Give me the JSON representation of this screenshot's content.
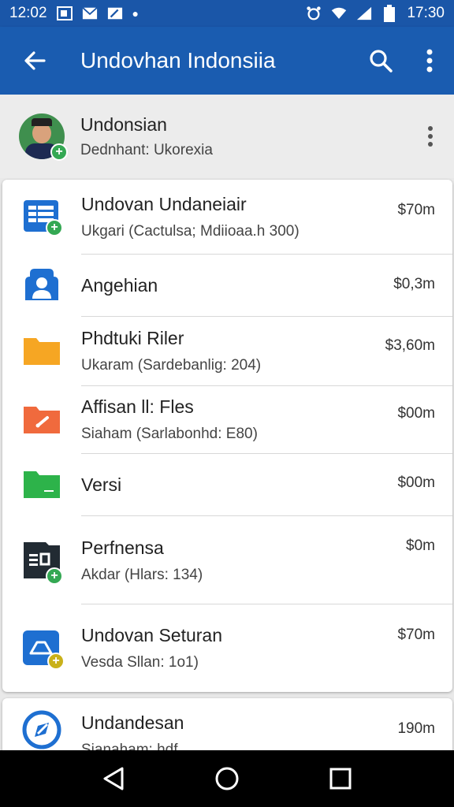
{
  "status_bar": {
    "time_left": "12:02",
    "time_right": "17:30"
  },
  "app_bar": {
    "title": "Undovhan Indonsiia"
  },
  "profile": {
    "name": "Undonsian",
    "subtitle": "Dednhant: Ukorexia"
  },
  "items": [
    {
      "name": "Undovan Undaneiair",
      "sub": "Ukgari (Cactulsa; Mdiioaa.h 300)",
      "size": "$70m",
      "icon": "spreadsheet-icon",
      "color": "#1e6fd1"
    },
    {
      "name": "Angehian",
      "sub": "",
      "size": "$0,3m",
      "icon": "contacts-icon",
      "color": "#1e6fd1"
    },
    {
      "name": "Phdtuki Riler",
      "sub": "Ukaram (Sardebanlig: 204)",
      "size": "$3,60m",
      "icon": "folder-icon",
      "color": "#f6a623"
    },
    {
      "name": "Affisan ll: Fles",
      "sub": "Siaham (Sarlabonhd: E80)",
      "size": "$00m",
      "icon": "folder-icon",
      "color": "#f06a3d"
    },
    {
      "name": "Versi",
      "sub": "",
      "size": "$00m",
      "icon": "folder-icon",
      "color": "#2db34a"
    },
    {
      "name": "Perfnensa",
      "sub": "Akdar (Hlars: 134)",
      "size": "$0m",
      "icon": "document-icon",
      "color": "#222b33"
    },
    {
      "name": "Undovan Seturan",
      "sub": "Vesda Sllan: 1o1)",
      "size": "$70m",
      "icon": "drive-icon",
      "color": "#1e6fd1"
    }
  ],
  "partial_item": {
    "name": "Undandesan",
    "sub": "Sianaham: hdf...",
    "size": "190m",
    "icon": "compass-icon",
    "color": "#1e6fd1"
  }
}
